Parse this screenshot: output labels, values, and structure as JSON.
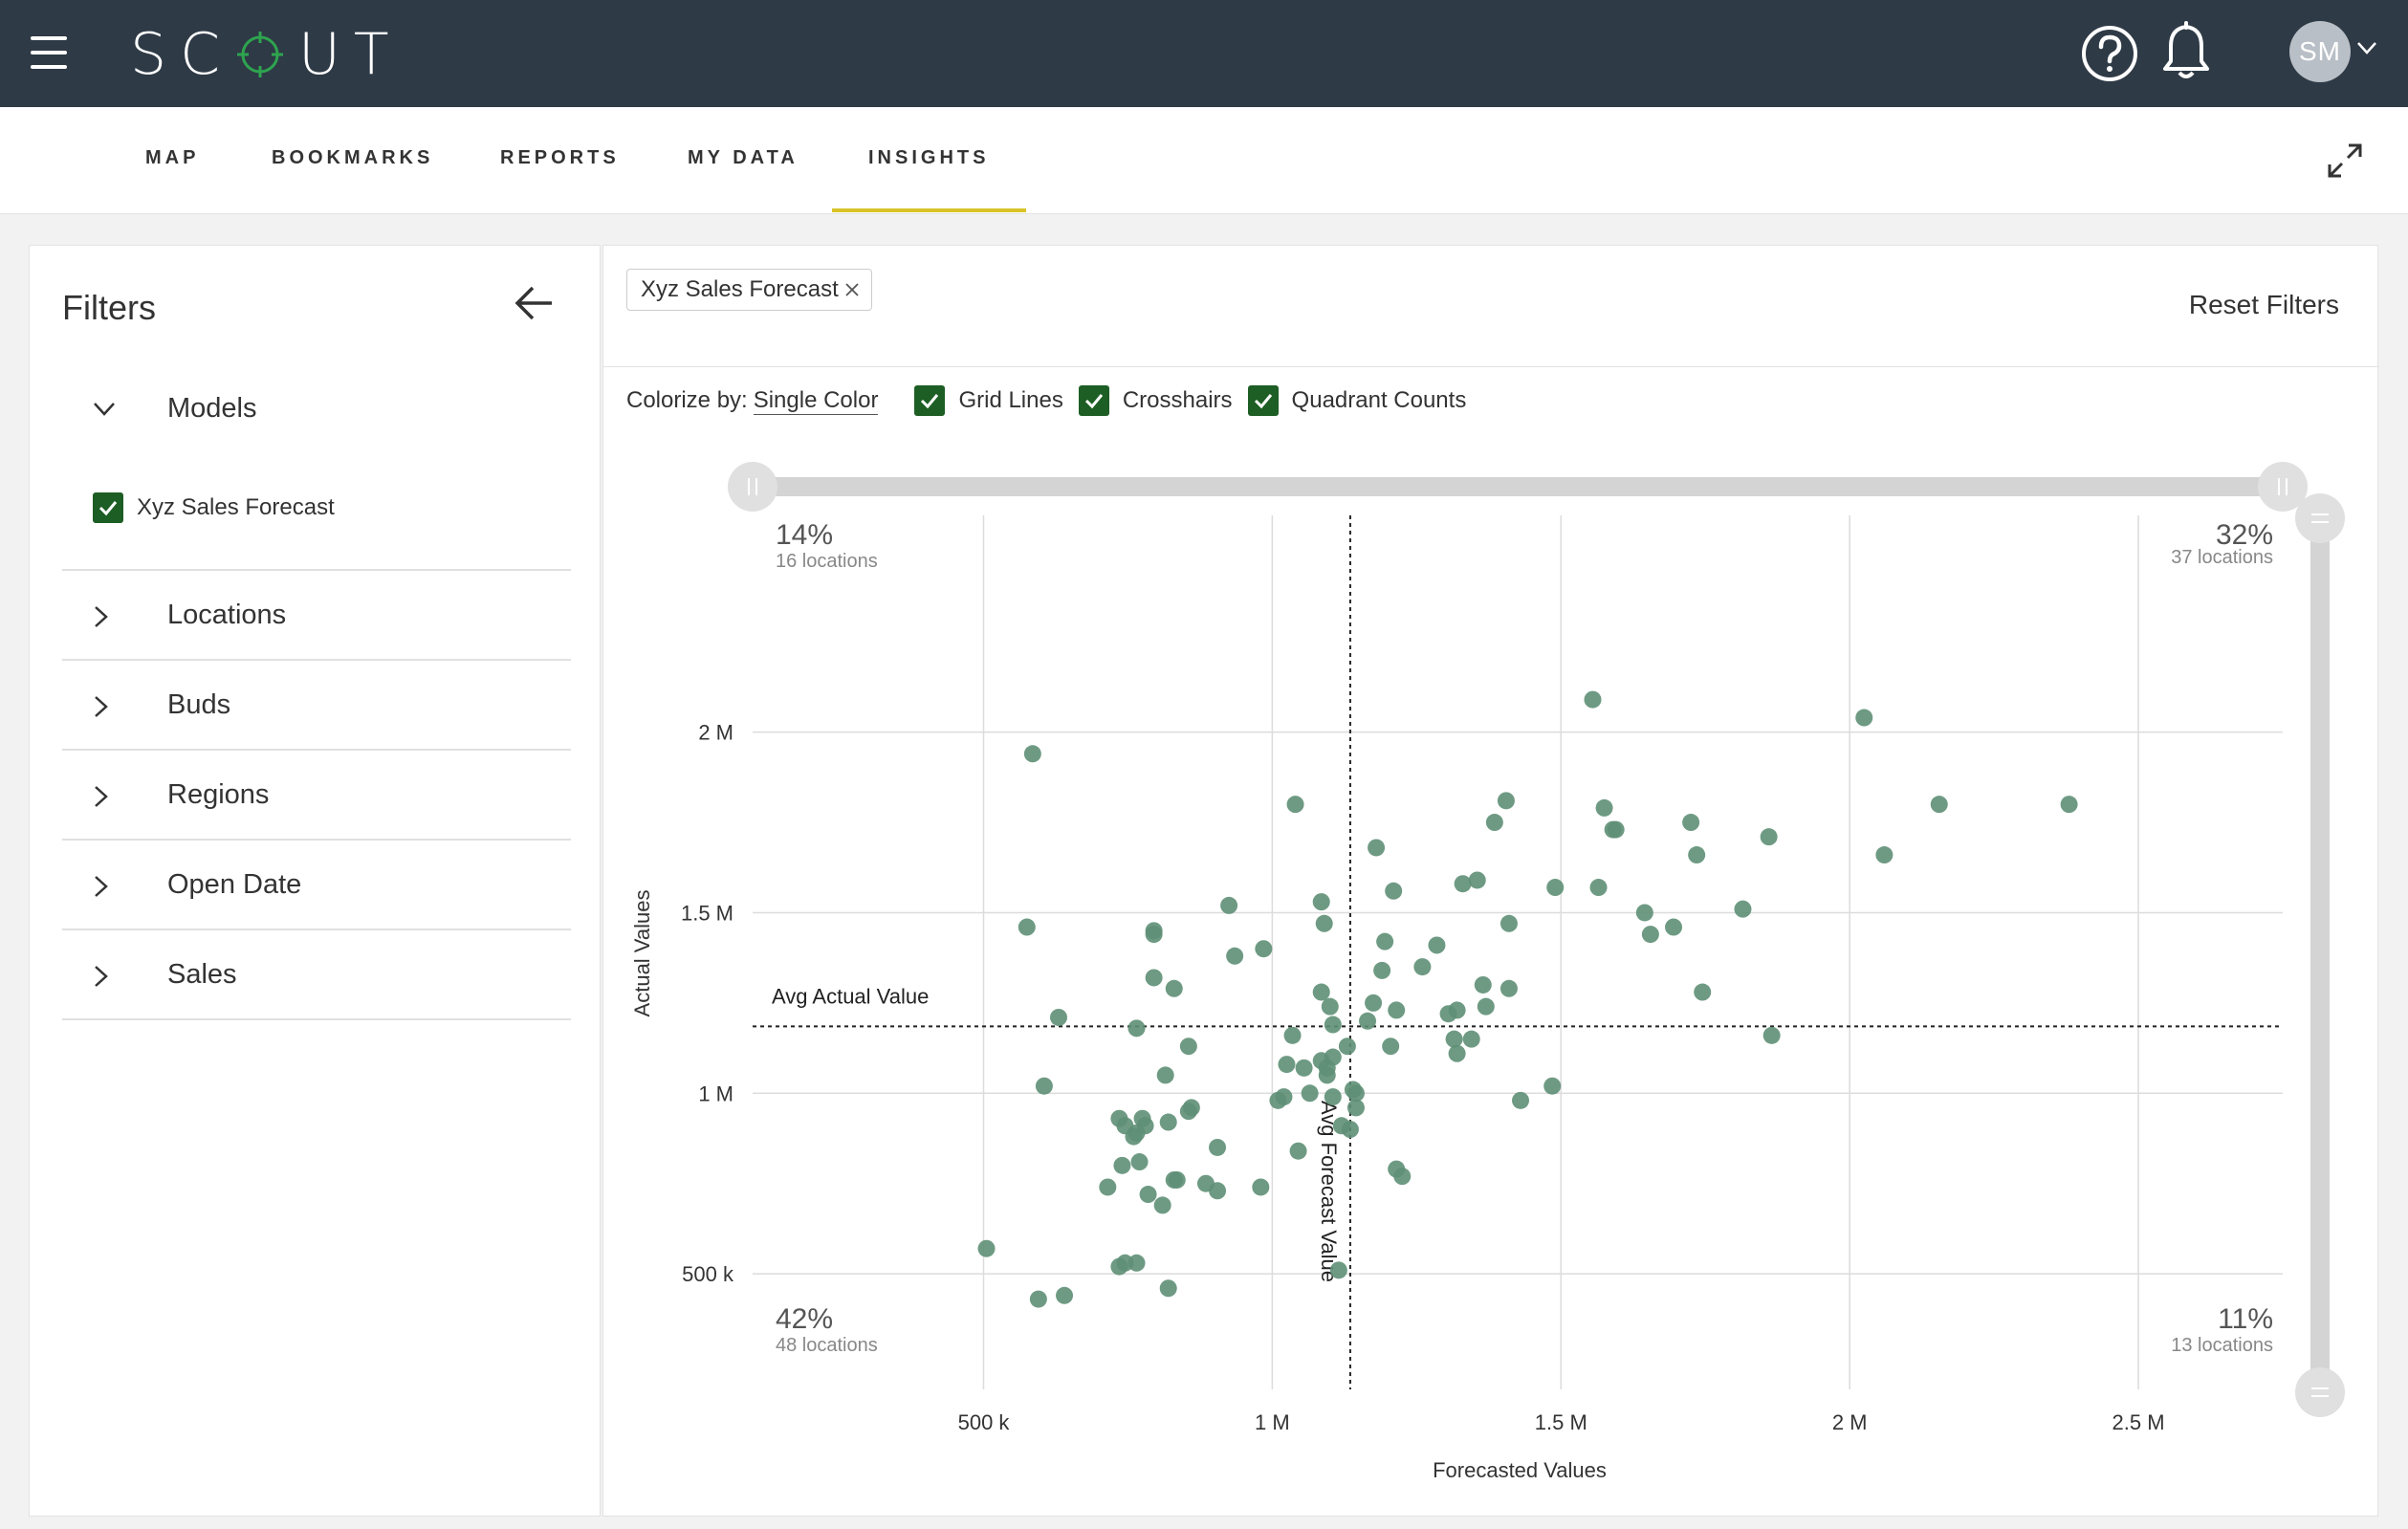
{
  "app": {
    "name": "SCOUT",
    "user_initials": "SM"
  },
  "nav": {
    "tabs": [
      "MAP",
      "BOOKMARKS",
      "REPORTS",
      "MY DATA",
      "INSIGHTS"
    ],
    "active": "INSIGHTS"
  },
  "filters": {
    "title": "Filters",
    "models_label": "Models",
    "model_item": "Xyz Sales Forecast",
    "rows": [
      "Locations",
      "Buds",
      "Regions",
      "Open Date",
      "Sales"
    ]
  },
  "main": {
    "chip": "Xyz Sales Forecast",
    "reset": "Reset Filters",
    "colorize_label": "Colorize by:",
    "colorize_value": "Single Color",
    "toggles": [
      "Grid Lines",
      "Crosshairs",
      "Quadrant Counts"
    ]
  },
  "colors": {
    "topbar": "#2e3a46",
    "accent": "#d8c427",
    "point": "#5e8f75",
    "check": "#1d5e24"
  },
  "chart_data": {
    "type": "scatter",
    "xlabel": "Forecasted Values",
    "ylabel": "Actual Values",
    "xlim": [
      100000,
      2750000
    ],
    "ylim": [
      180000,
      2600000
    ],
    "x_ticks": [
      500000,
      1000000,
      1500000,
      2000000,
      2500000
    ],
    "x_tick_labels": [
      "500 k",
      "1 M",
      "1.5 M",
      "2 M",
      "2.5 M"
    ],
    "y_ticks": [
      500000,
      1000000,
      1500000,
      2000000
    ],
    "y_tick_labels": [
      "500 k",
      "1 M",
      "1.5 M",
      "2 M"
    ],
    "grid": true,
    "avg_forecast": 1135000,
    "avg_actual": 1185000,
    "avg_forecast_label": "Avg Forecast Value",
    "avg_actual_label": "Avg Actual Value",
    "quadrants": {
      "top_left": {
        "pct": "14%",
        "count": "16 locations"
      },
      "top_right": {
        "pct": "32%",
        "count": "37 locations"
      },
      "bottom_left": {
        "pct": "42%",
        "count": "48 locations"
      },
      "bottom_right": {
        "pct": "11%",
        "count": "13 locations"
      }
    },
    "points": [
      [
        1555000,
        2090000
      ],
      [
        2025000,
        2040000
      ],
      [
        585000,
        1940000
      ],
      [
        1040000,
        1800000
      ],
      [
        1405000,
        1810000
      ],
      [
        1575000,
        1790000
      ],
      [
        1595000,
        1730000
      ],
      [
        1590000,
        1730000
      ],
      [
        1385000,
        1750000
      ],
      [
        1725000,
        1750000
      ],
      [
        2155000,
        1800000
      ],
      [
        2380000,
        1800000
      ],
      [
        1860000,
        1710000
      ],
      [
        1735000,
        1660000
      ],
      [
        2060000,
        1660000
      ],
      [
        1180000,
        1680000
      ],
      [
        1355000,
        1590000
      ],
      [
        1330000,
        1580000
      ],
      [
        1490000,
        1570000
      ],
      [
        1565000,
        1570000
      ],
      [
        1210000,
        1560000
      ],
      [
        925000,
        1520000
      ],
      [
        1085000,
        1530000
      ],
      [
        1090000,
        1470000
      ],
      [
        1815000,
        1510000
      ],
      [
        1645000,
        1500000
      ],
      [
        1695000,
        1460000
      ],
      [
        575000,
        1460000
      ],
      [
        795000,
        1450000
      ],
      [
        795000,
        1440000
      ],
      [
        1410000,
        1470000
      ],
      [
        1195000,
        1420000
      ],
      [
        1285000,
        1410000
      ],
      [
        1655000,
        1440000
      ],
      [
        985000,
        1400000
      ],
      [
        935000,
        1380000
      ],
      [
        1260000,
        1350000
      ],
      [
        1190000,
        1340000
      ],
      [
        795000,
        1320000
      ],
      [
        830000,
        1290000
      ],
      [
        1365000,
        1300000
      ],
      [
        1410000,
        1290000
      ],
      [
        1085000,
        1280000
      ],
      [
        1745000,
        1280000
      ],
      [
        1100000,
        1240000
      ],
      [
        1175000,
        1250000
      ],
      [
        1370000,
        1240000
      ],
      [
        1320000,
        1230000
      ],
      [
        1215000,
        1230000
      ],
      [
        1305000,
        1220000
      ],
      [
        1165000,
        1200000
      ],
      [
        1105000,
        1190000
      ],
      [
        630000,
        1210000
      ],
      [
        765000,
        1180000
      ],
      [
        1035000,
        1160000
      ],
      [
        1315000,
        1150000
      ],
      [
        1345000,
        1150000
      ],
      [
        1865000,
        1160000
      ],
      [
        1130000,
        1130000
      ],
      [
        1205000,
        1130000
      ],
      [
        855000,
        1130000
      ],
      [
        1320000,
        1110000
      ],
      [
        1085000,
        1090000
      ],
      [
        1105000,
        1100000
      ],
      [
        1025000,
        1080000
      ],
      [
        1055000,
        1070000
      ],
      [
        1095000,
        1050000
      ],
      [
        1095000,
        1070000
      ],
      [
        1065000,
        1000000
      ],
      [
        1145000,
        1000000
      ],
      [
        815000,
        1050000
      ],
      [
        605000,
        1020000
      ],
      [
        1485000,
        1020000
      ],
      [
        1430000,
        980000
      ],
      [
        1105000,
        990000
      ],
      [
        1020000,
        990000
      ],
      [
        1010000,
        980000
      ],
      [
        1140000,
        1010000
      ],
      [
        1145000,
        960000
      ],
      [
        860000,
        960000
      ],
      [
        855000,
        950000
      ],
      [
        735000,
        930000
      ],
      [
        775000,
        930000
      ],
      [
        820000,
        920000
      ],
      [
        745000,
        910000
      ],
      [
        780000,
        910000
      ],
      [
        765000,
        890000
      ],
      [
        760000,
        880000
      ],
      [
        1120000,
        910000
      ],
      [
        1135000,
        900000
      ],
      [
        905000,
        850000
      ],
      [
        1045000,
        840000
      ],
      [
        770000,
        810000
      ],
      [
        740000,
        800000
      ],
      [
        1215000,
        790000
      ],
      [
        1225000,
        770000
      ],
      [
        835000,
        760000
      ],
      [
        830000,
        760000
      ],
      [
        885000,
        750000
      ],
      [
        905000,
        730000
      ],
      [
        715000,
        740000
      ],
      [
        980000,
        740000
      ],
      [
        785000,
        720000
      ],
      [
        810000,
        690000
      ],
      [
        505000,
        570000
      ],
      [
        745000,
        530000
      ],
      [
        735000,
        520000
      ],
      [
        765000,
        530000
      ],
      [
        1115000,
        510000
      ],
      [
        820000,
        460000
      ],
      [
        595000,
        430000
      ],
      [
        640000,
        440000
      ]
    ]
  }
}
